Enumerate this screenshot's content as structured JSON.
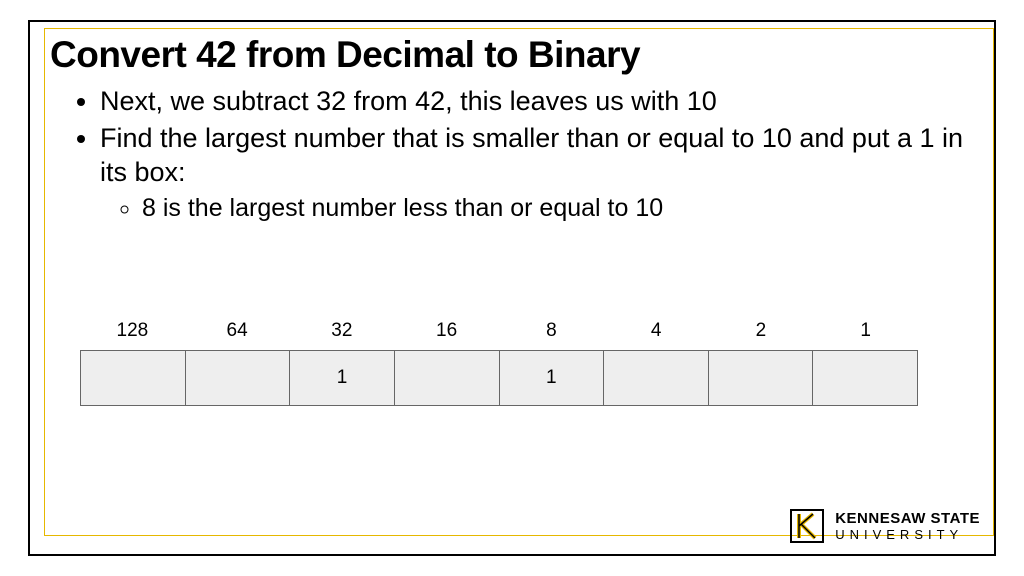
{
  "title": "Convert 42 from Decimal to Binary",
  "bullets": [
    "Next, we subtract 32 from 42, this leaves us with 10",
    "Find the largest number that is smaller than or equal to 10 and put a 1 in its box:"
  ],
  "sub_bullets": [
    "8 is the largest number less than or equal to 10"
  ],
  "table": {
    "headers": [
      "128",
      "64",
      "32",
      "16",
      "8",
      "4",
      "2",
      "1"
    ],
    "values": [
      "",
      "",
      "1",
      "",
      "1",
      "",
      "",
      ""
    ]
  },
  "logo": {
    "line1": "KENNESAW STATE",
    "line2": "UNIVERSITY"
  },
  "chart_data": {
    "type": "table",
    "title": "Binary place-value table for converting 42",
    "columns": [
      "128",
      "64",
      "32",
      "16",
      "8",
      "4",
      "2",
      "1"
    ],
    "row": [
      "",
      "",
      "1",
      "",
      "1",
      "",
      "",
      ""
    ]
  }
}
